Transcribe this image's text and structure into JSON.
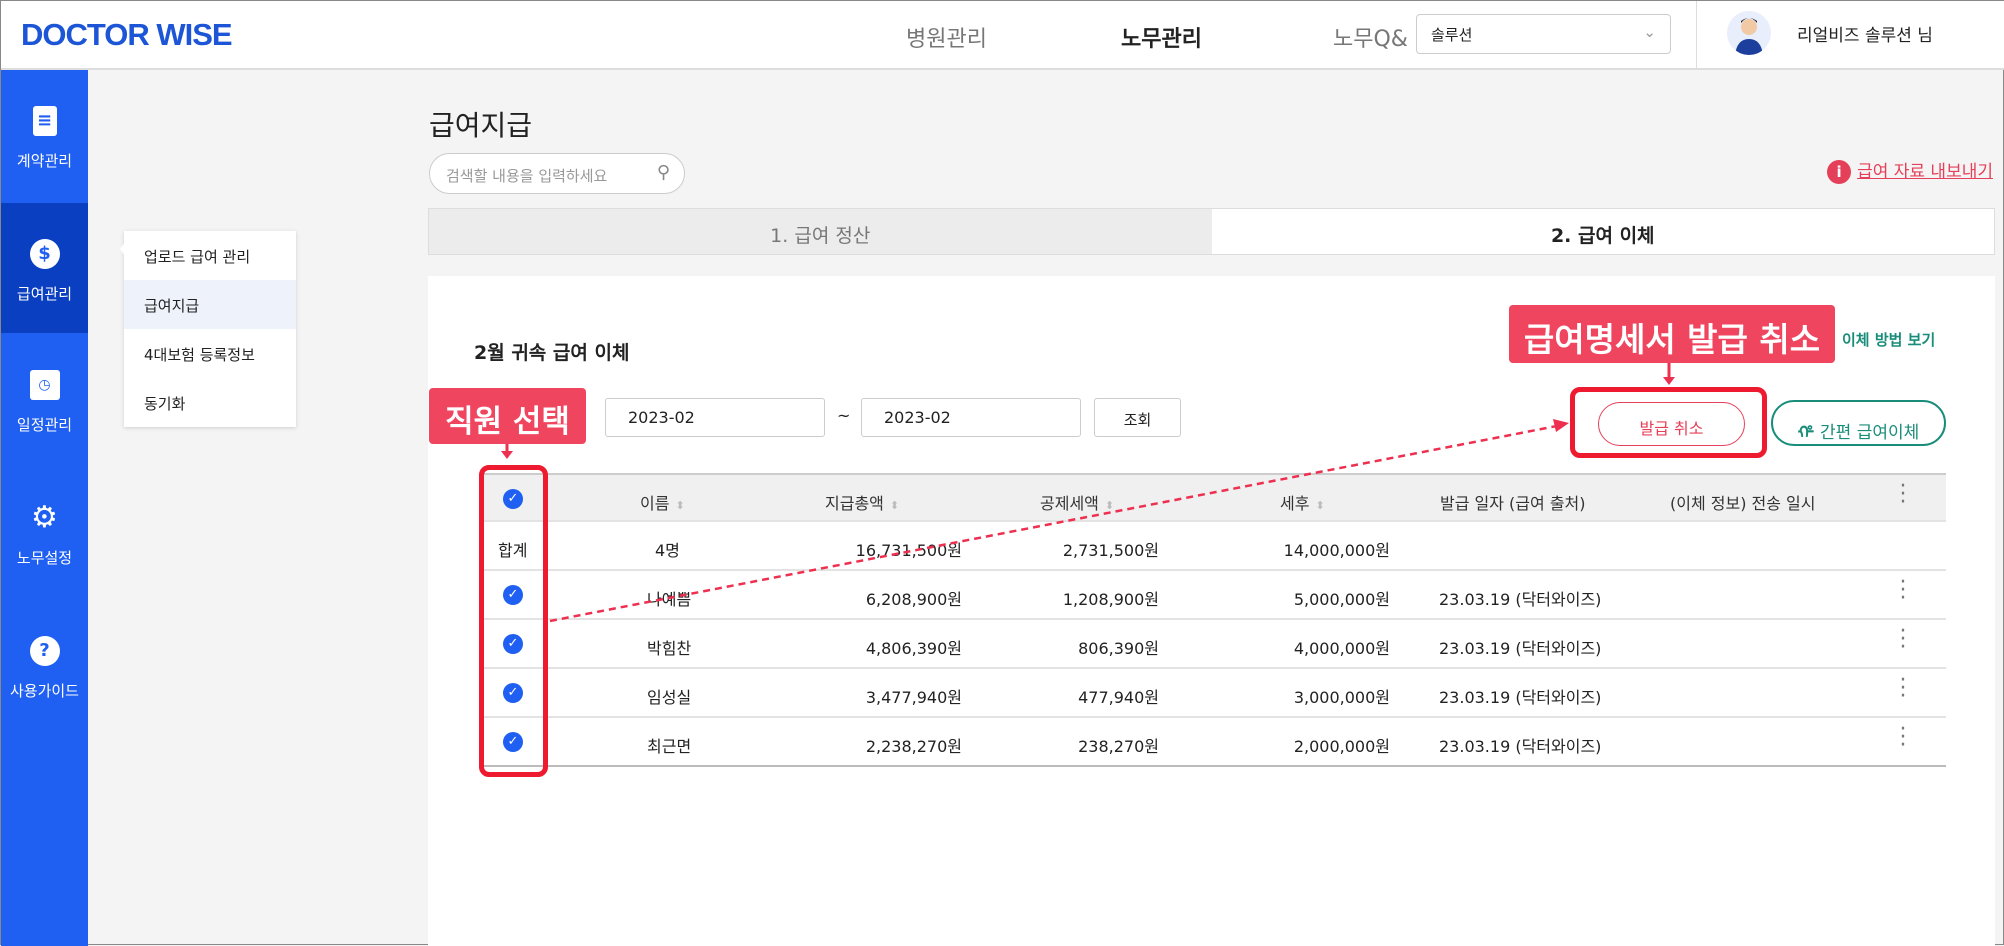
{
  "header": {
    "logo": "DOCTOR WISE",
    "nav": [
      "병원관리",
      "노무관리",
      "노무Q&"
    ],
    "solution_select": "솔루션",
    "user": "리얼비즈 솔루션 님"
  },
  "sidebar": {
    "items": [
      {
        "label": "계약관리",
        "icon": "document-icon"
      },
      {
        "label": "급여관리",
        "icon": "dollar-icon"
      },
      {
        "label": "일정관리",
        "icon": "calendar-icon"
      },
      {
        "label": "노무설정",
        "icon": "gear-icon"
      },
      {
        "label": "사용가이드",
        "icon": "question-icon"
      }
    ]
  },
  "submenu": [
    "업로드 급여 관리",
    "급여지급",
    "4대보험 등록정보",
    "동기화"
  ],
  "page": {
    "title": "급여지급",
    "search_placeholder": "검색할 내용을 입력하세요",
    "export": "급여 자료 내보내기",
    "tabs": [
      "1. 급여 정산",
      "2. 급여 이체"
    ]
  },
  "panel": {
    "title": "2월 귀속 급여 이체",
    "how_to": "이체 방법 보기",
    "date_from": "2023-02",
    "tilde": "~",
    "date_to": "2023-02",
    "query": "조회",
    "cancel_issue": "발급 취소",
    "easy_transfer": "간편 급여이체"
  },
  "annotations": {
    "cancel": "급여명세서 발급 취소",
    "select": "직원 선택"
  },
  "table": {
    "headers": [
      "이름",
      "지급총액",
      "공제세액",
      "세후",
      "발급 일자 (급여 출처)",
      "(이체 정보) 전송 일시"
    ],
    "total": {
      "label": "합계",
      "count": "4명",
      "gross": "16,731,500원",
      "deduction": "2,731,500원",
      "net": "14,000,000원"
    },
    "rows": [
      {
        "name": "나예쁨",
        "gross": "6,208,900원",
        "deduction": "1,208,900원",
        "net": "5,000,000원",
        "issued": "23.03.19 (닥터와이즈)"
      },
      {
        "name": "박힘찬",
        "gross": "4,806,390원",
        "deduction": "806,390원",
        "net": "4,000,000원",
        "issued": "23.03.19 (닥터와이즈)"
      },
      {
        "name": "임성실",
        "gross": "3,477,940원",
        "deduction": "477,940원",
        "net": "3,000,000원",
        "issued": "23.03.19 (닥터와이즈)"
      },
      {
        "name": "최근면",
        "gross": "2,238,270원",
        "deduction": "238,270원",
        "net": "2,000,000원",
        "issued": "23.03.19 (닥터와이즈)"
      }
    ]
  }
}
